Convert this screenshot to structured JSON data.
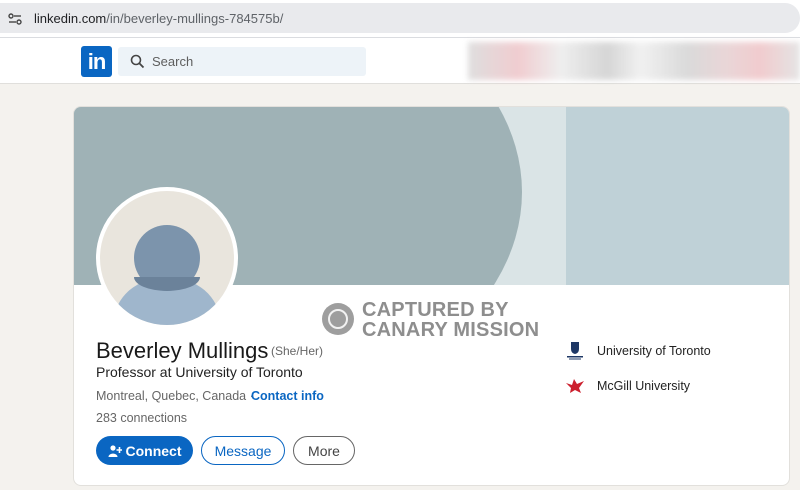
{
  "browser": {
    "url_host": "linkedin.com",
    "url_path": "/in/beverley-mullings-784575b/"
  },
  "header": {
    "logo_text": "in",
    "search_placeholder": "Search"
  },
  "profile": {
    "name": "Beverley Mullings",
    "pronouns": "(She/Her)",
    "headline": "Professor at University of Toronto",
    "location": "Montreal, Quebec, Canada ·",
    "contact_info_label": "Contact info",
    "connections": "283 connections",
    "actions": {
      "connect_label": "Connect",
      "message_label": "Message",
      "more_label": "More"
    },
    "education": [
      {
        "name": "University of Toronto",
        "icon": "university-of-toronto-crest-icon"
      },
      {
        "name": "McGill University",
        "icon": "mcgill-bird-icon"
      }
    ]
  },
  "watermark": {
    "line1": "CAPTURED BY",
    "line2": "CANARY MISSION"
  },
  "colors": {
    "brand_blue": "#0a66c2",
    "banner_light": "#bfd1d7",
    "banner_dark": "#9fb2b6",
    "mcgill_red": "#cc1f2d"
  }
}
